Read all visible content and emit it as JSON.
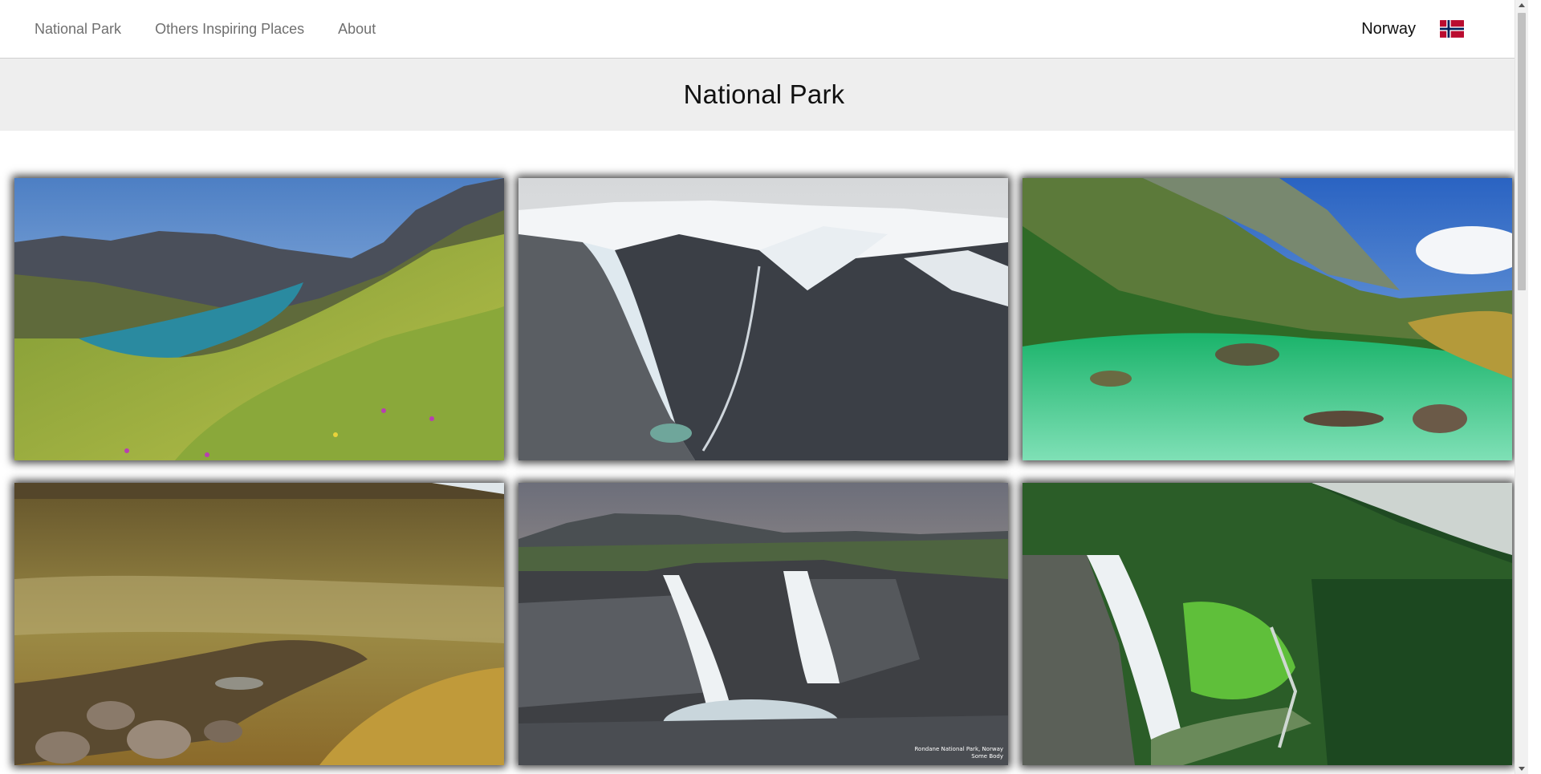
{
  "nav": {
    "links": [
      "National Park",
      "Others Inspiring Places",
      "About"
    ],
    "country": "Norway",
    "flag_icon": "norway-flag-icon"
  },
  "header": {
    "title": "National Park"
  },
  "gallery": {
    "images": [
      {
        "subject": "mountain lake with wildflowers"
      },
      {
        "subject": "glacier over mountain valley"
      },
      {
        "subject": "emerald river in green valley"
      },
      {
        "subject": "golden tundra with rocky stream"
      },
      {
        "subject": "waterfalls over rocky cliffs",
        "caption_line1": "Rondane National Park, Norway",
        "caption_line2": "Some Body"
      },
      {
        "subject": "waterfall in green forest gorge"
      }
    ]
  },
  "colors": {
    "nav_text": "#6f6f6f",
    "title_band": "#eeeeee",
    "text_dark": "#111111"
  }
}
